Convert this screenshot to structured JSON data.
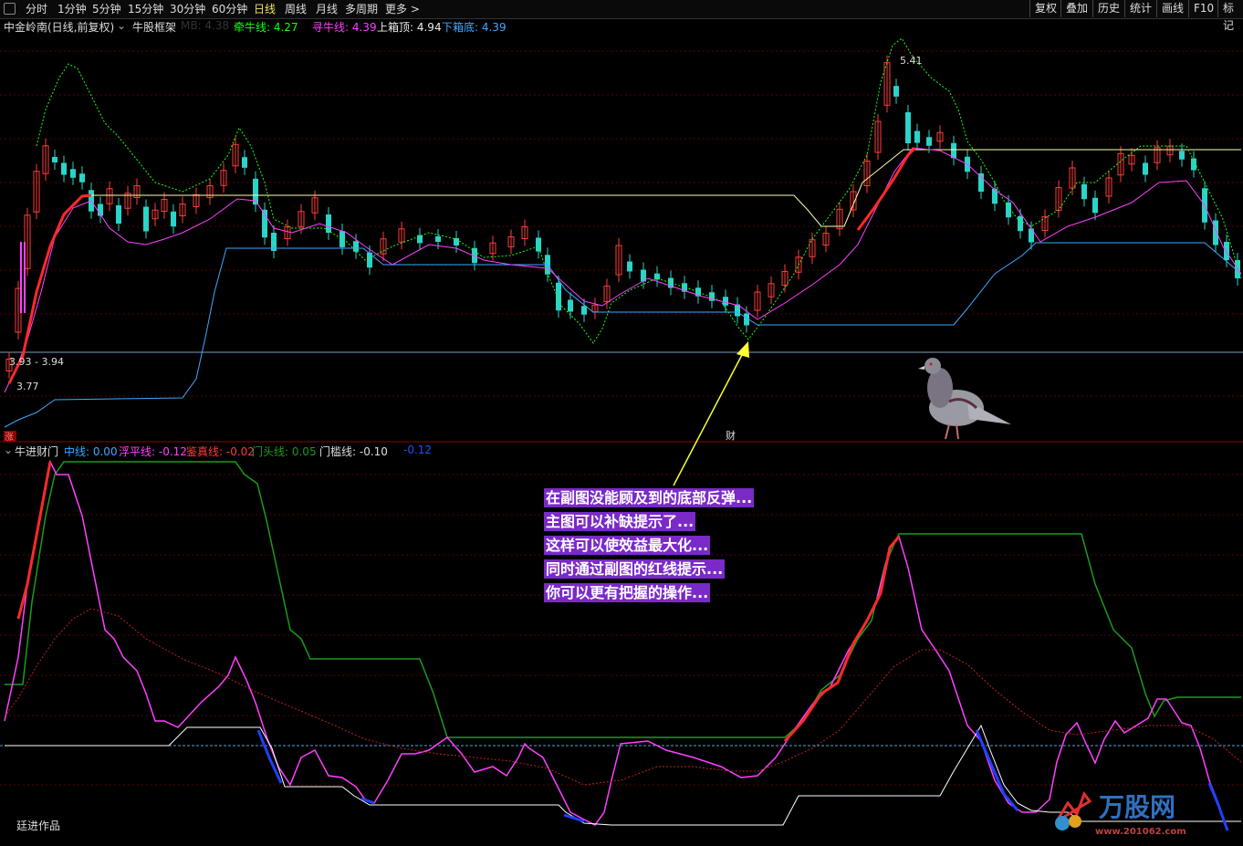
{
  "toolbar": {
    "tabs": [
      "分时",
      "1分钟",
      "5分钟",
      "15分钟",
      "30分钟",
      "60分钟",
      "日线",
      "周线",
      "月线",
      "多周期",
      "更多 >"
    ],
    "active_tab": "日线",
    "right_buttons": [
      "复权",
      "叠加",
      "历史",
      "统计",
      "画线",
      "F10",
      "标记"
    ]
  },
  "main_info": {
    "stock": "中金岭南(日线,前复权)",
    "indicator": "牛股框架",
    "mb_label": "MB: 4.38",
    "qianniu": "牵牛线: 4.27",
    "xunniu": "寻牛线: 4.39",
    "shangxiang": "上箱顶: 4.94",
    "xiaxiang": "下箱底: 4.39"
  },
  "main_labels": {
    "high": "5.41",
    "range": "3.93 - 3.94",
    "low": "3.77",
    "zhang": "涨",
    "cai": "财"
  },
  "sub_info": {
    "name": "牛进财门",
    "zhongxian": "中线: 0.00",
    "fupingxian": "浮平线: -0.12",
    "jianzhenxian": "鉴真线: -0.02",
    "mentouxian": "门头线: 0.05",
    "menkanxian": "门槛线: -0.10",
    "extra": "-0.12"
  },
  "callout": [
    "在副图没能顾及到的底部反弹...",
    "主图可以补缺提示了...",
    "这样可以使效益最大化...",
    "同时通过副图的红线提示...",
    "你可以更有把握的操作..."
  ],
  "author": "廷进作品",
  "watermark": {
    "brand": "万股网",
    "url": "www.201062.com"
  },
  "colors": {
    "up": "#ff3b3b",
    "down": "#2ad4c8",
    "qianniu": "#1aff1a",
    "xunniu": "#ff40ff",
    "shangxiang": "#ffffaa",
    "xiaxiang": "#3fa8ff",
    "callout_bg": "#7a2ac8"
  }
}
